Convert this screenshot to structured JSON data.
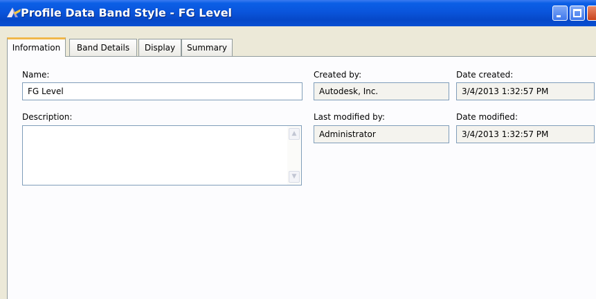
{
  "window": {
    "title": "Profile Data Band Style - FG Level",
    "app_icon": "civil3d-icon"
  },
  "tabs": [
    {
      "label": "Information",
      "active": true
    },
    {
      "label": "Band Details",
      "active": false
    },
    {
      "label": "Display",
      "active": false
    },
    {
      "label": "Summary",
      "active": false
    }
  ],
  "form": {
    "name_label": "Name:",
    "name_value": "FG Level",
    "description_label": "Description:",
    "description_value": "",
    "created_by_label": "Created by:",
    "created_by_value": "Autodesk, Inc.",
    "date_created_label": "Date created:",
    "date_created_value": "3/4/2013 1:32:57 PM",
    "last_modified_by_label": "Last modified by:",
    "last_modified_by_value": "Administrator",
    "date_modified_label": "Date modified:",
    "date_modified_value": "3/4/2013 1:32:57 PM"
  },
  "colors": {
    "titlebar": "#0a55dc",
    "active_tab_accent": "#f0b74a",
    "field_border": "#7f9db9"
  }
}
